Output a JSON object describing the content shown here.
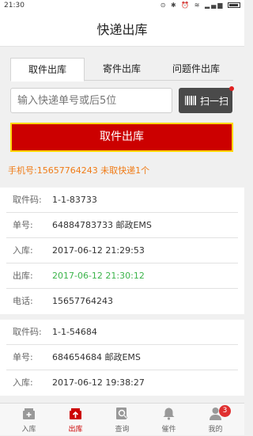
{
  "status_bar": {
    "time": "21:30",
    "icons": "⊙ ✱ ⏰ ≋ ▂▄▆"
  },
  "header": {
    "title": "快递出库"
  },
  "tabs": [
    {
      "label": "取件出库",
      "active": true
    },
    {
      "label": "寄件出库",
      "active": false
    },
    {
      "label": "问题件出库",
      "active": false
    }
  ],
  "search": {
    "placeholder": "输入快递单号或后5位",
    "scan_label": "扫一扫"
  },
  "pickup_button": "取件出库",
  "summary": "手机号:15657764243 未取快递1个",
  "records": [
    {
      "rows": [
        {
          "k": "取件码:",
          "v": "1-1-83733",
          "highlight": false
        },
        {
          "k": "单号:",
          "v": "64884783733 邮政EMS",
          "highlight": false
        },
        {
          "k": "入库:",
          "v": "2017-06-12 21:29:53",
          "highlight": false
        },
        {
          "k": "出库:",
          "v": "2017-06-12 21:30:12",
          "highlight": true
        },
        {
          "k": "电话:",
          "v": "15657764243",
          "highlight": false
        }
      ]
    },
    {
      "rows": [
        {
          "k": "取件码:",
          "v": "1-1-54684",
          "highlight": false
        },
        {
          "k": "单号:",
          "v": "684654684 邮政EMS",
          "highlight": false
        },
        {
          "k": "入库:",
          "v": "2017-06-12 19:38:27",
          "highlight": false
        }
      ]
    }
  ],
  "bottom_nav": [
    {
      "label": "入库",
      "icon": "inbox-icon",
      "active": false
    },
    {
      "label": "出库",
      "icon": "outbox-icon",
      "active": true
    },
    {
      "label": "查询",
      "icon": "search-doc-icon",
      "active": false
    },
    {
      "label": "催件",
      "icon": "bell-icon",
      "active": false
    },
    {
      "label": "我的",
      "icon": "user-icon",
      "active": false,
      "badge": "3"
    }
  ],
  "colors": {
    "accent": "#cc0000",
    "highlight_green": "#3bb44a",
    "summary_orange": "#f07b16"
  }
}
